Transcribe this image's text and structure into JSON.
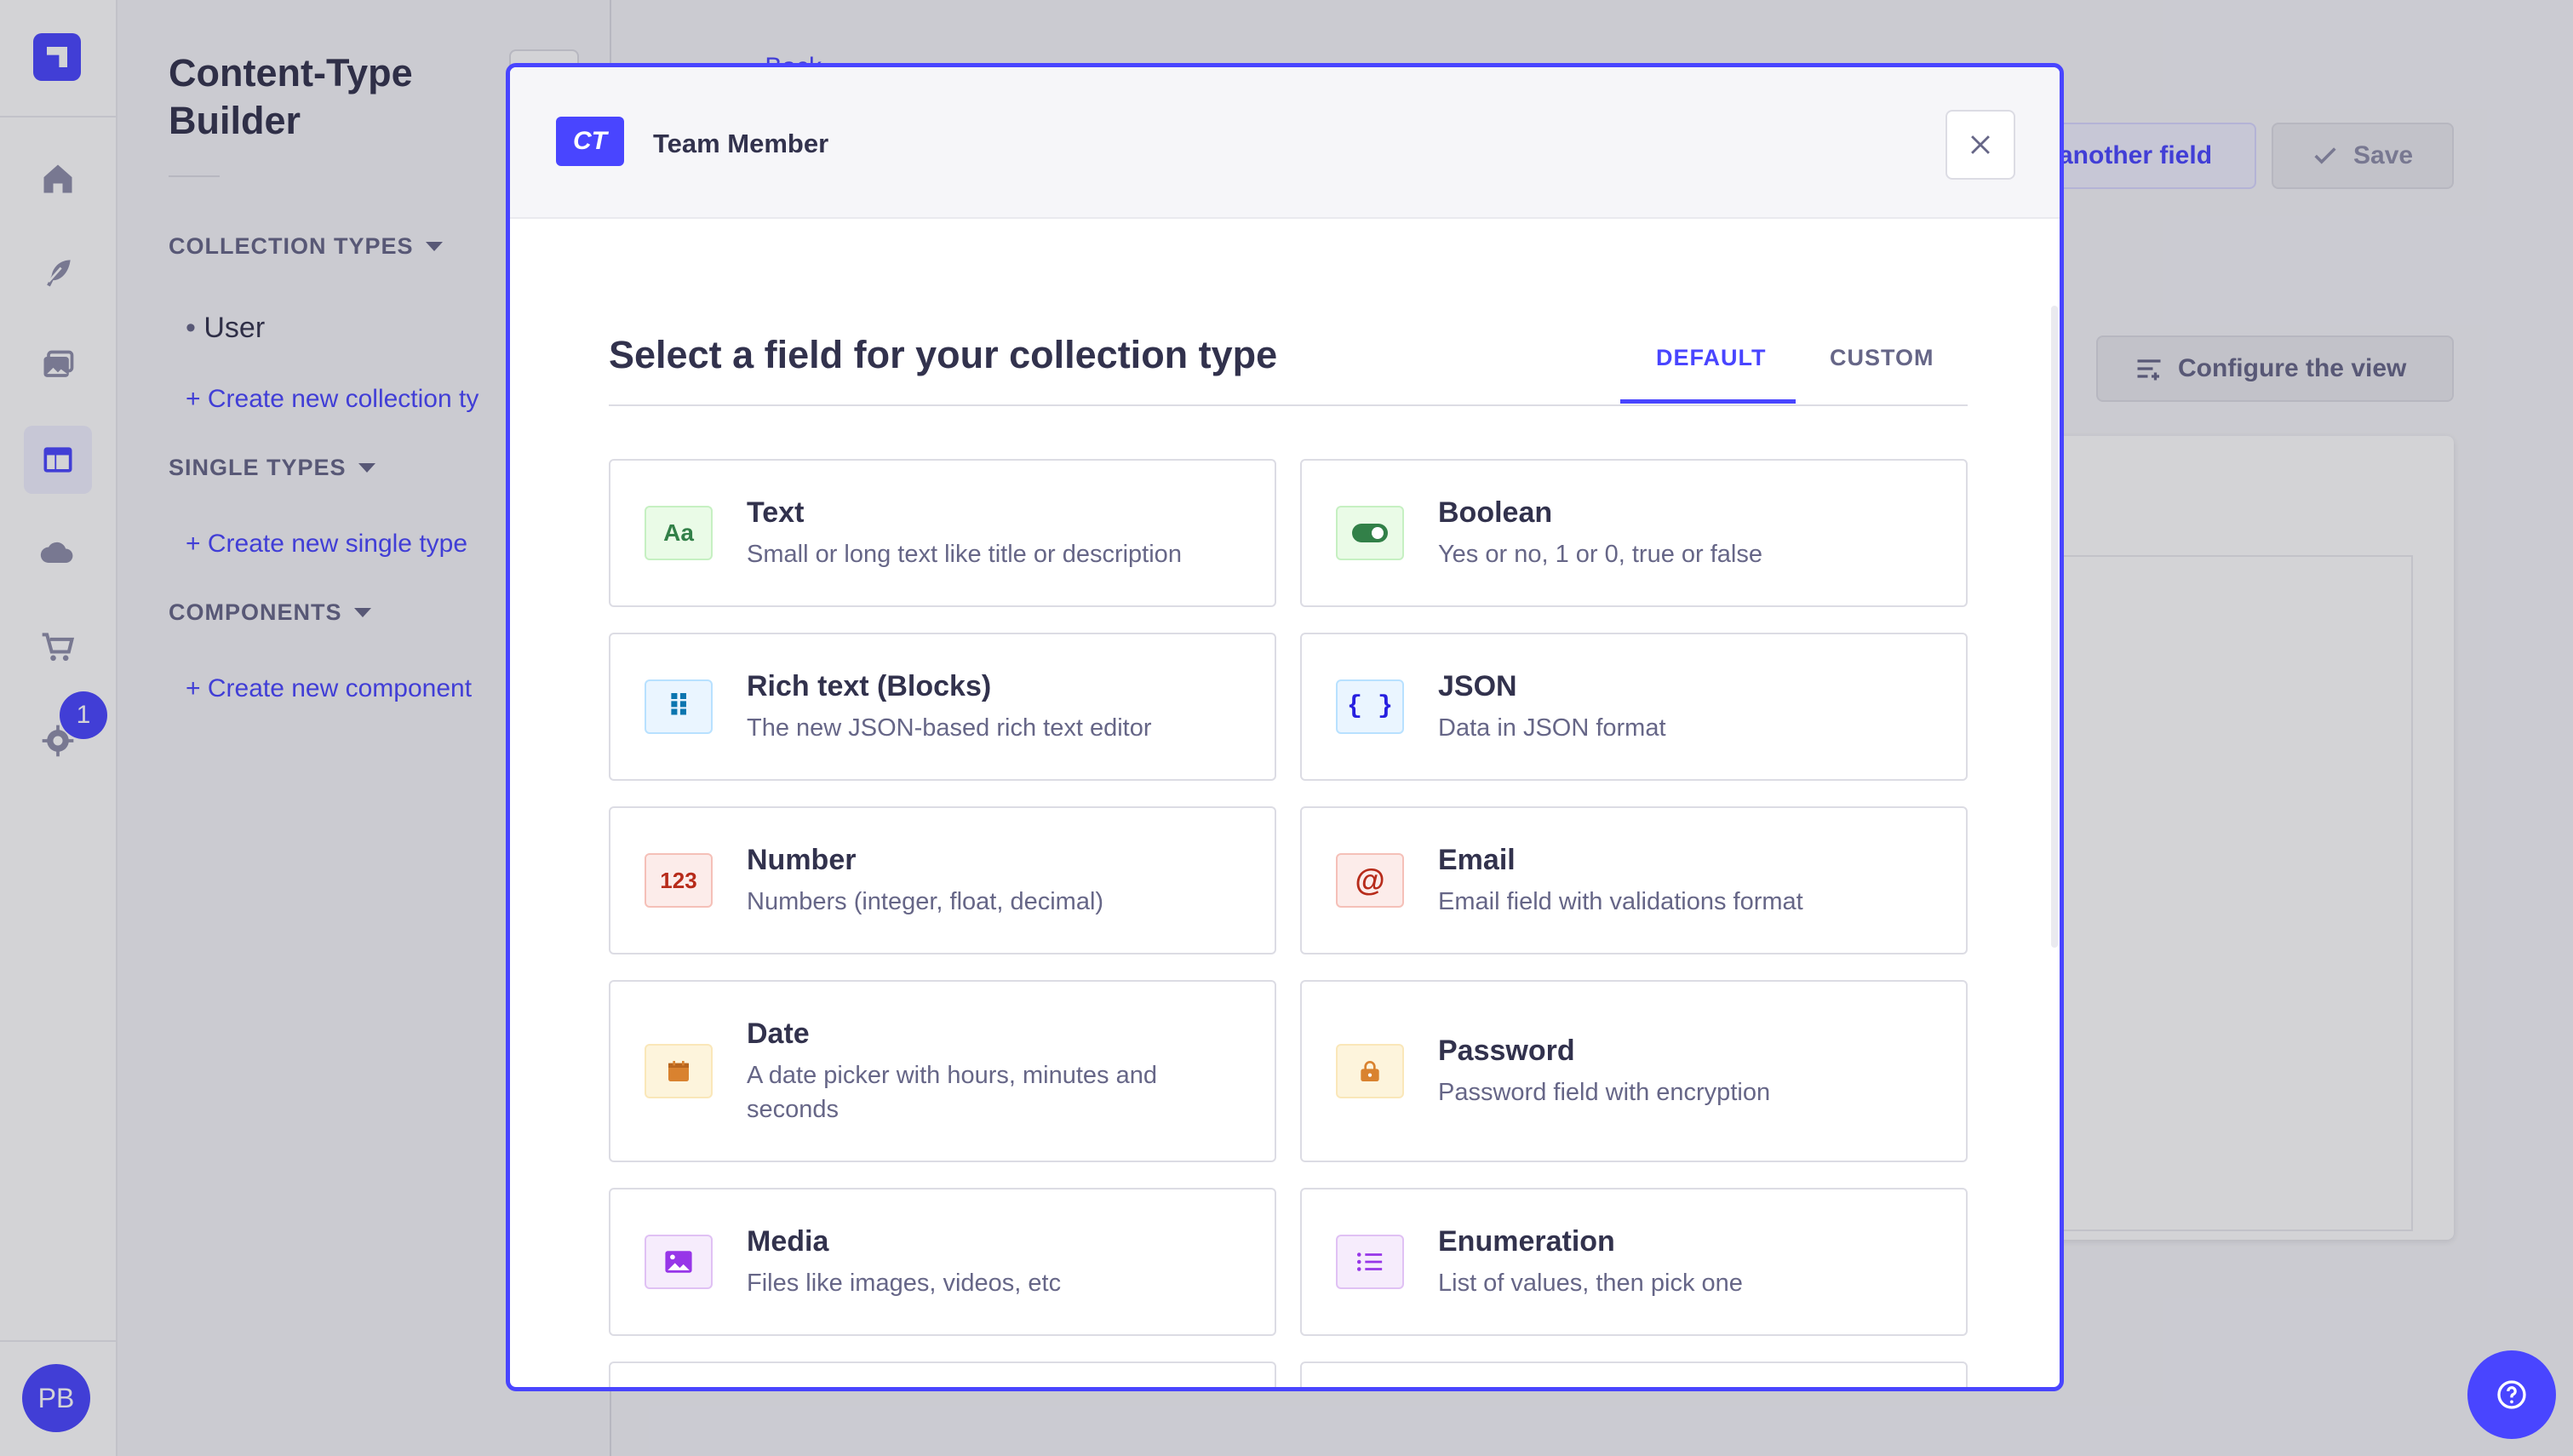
{
  "rail": {
    "badge_count": "1",
    "avatar_initials": "PB"
  },
  "subnav": {
    "title": "Content-Type Builder",
    "sections": {
      "collection": "COLLECTION TYPES",
      "single": "SINGLE TYPES",
      "components": "COMPONENTS"
    },
    "collection_item": "User",
    "links": {
      "collection": "+  Create new collection ty",
      "single": "+  Create new single type",
      "component": "+  Create new component"
    }
  },
  "background": {
    "back_label": "Back",
    "add_field_label": "another field",
    "save_label": "Save",
    "configure_label": "Configure the view"
  },
  "modal": {
    "badge": "CT",
    "title": "Team Member",
    "heading": "Select a field for your collection type",
    "tabs": {
      "default": "DEFAULT",
      "custom": "CUSTOM"
    },
    "fields": [
      {
        "name": "Text",
        "desc": "Small or long text like title or description",
        "icon": "text-icon",
        "glyph": "Aa"
      },
      {
        "name": "Boolean",
        "desc": "Yes or no, 1 or 0, true or false",
        "icon": "toggle-icon",
        "glyph": ""
      },
      {
        "name": "Rich text (Blocks)",
        "desc": "The new JSON-based rich text editor",
        "icon": "grip-icon",
        "glyph": "⠿"
      },
      {
        "name": "JSON",
        "desc": "Data in JSON format",
        "icon": "braces-icon",
        "glyph": "{ }"
      },
      {
        "name": "Number",
        "desc": "Numbers (integer, float, decimal)",
        "icon": "number-icon",
        "glyph": "123"
      },
      {
        "name": "Email",
        "desc": "Email field with validations format",
        "icon": "at-icon",
        "glyph": "@"
      },
      {
        "name": "Date",
        "desc": "A date picker with hours, minutes and seconds",
        "icon": "calendar-icon",
        "glyph": ""
      },
      {
        "name": "Password",
        "desc": "Password field with encryption",
        "icon": "lock-icon",
        "glyph": ""
      },
      {
        "name": "Media",
        "desc": "Files like images, videos, etc",
        "icon": "image-icon",
        "glyph": ""
      },
      {
        "name": "Enumeration",
        "desc": "List of values, then pick one",
        "icon": "list-icon",
        "glyph": ""
      }
    ]
  },
  "colors": {
    "primary": "#4945ff",
    "text": "#32324d",
    "muted": "#666687",
    "border": "#dcdce4"
  }
}
